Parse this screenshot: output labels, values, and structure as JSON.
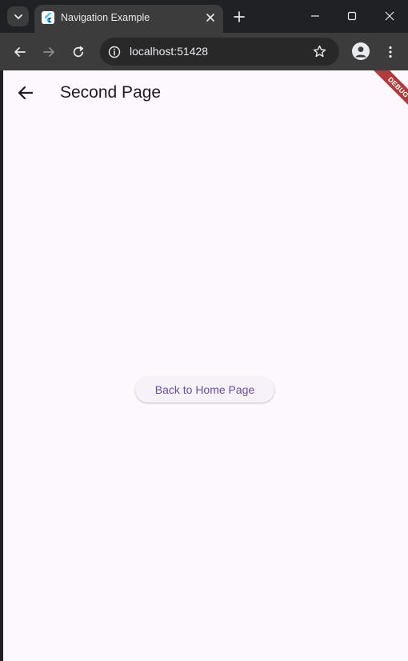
{
  "browser": {
    "tab": {
      "title": "Navigation Example"
    },
    "address_bar": {
      "url": "localhost:51428"
    }
  },
  "app": {
    "title": "Second Page",
    "button_label": "Back to Home Page",
    "debug_banner": "DEBUG",
    "colors": {
      "background": "#fdf7fe",
      "button_text": "#6750a4",
      "button_bg": "#f7f1fa",
      "debug": "#b13a3a"
    }
  }
}
